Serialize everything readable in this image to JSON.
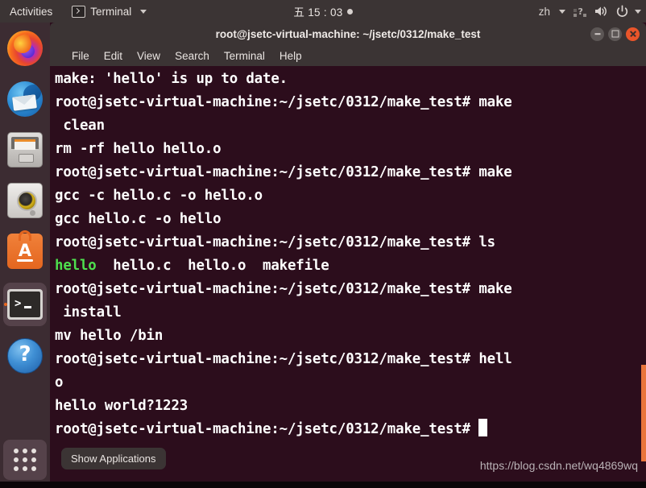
{
  "topbar": {
    "activities": "Activities",
    "app_name": "Terminal",
    "app_icon": "terminal-icon",
    "clock": "五 15 : 03",
    "language": "zh",
    "network_icon": "network-icon",
    "volume_icon": "volume-icon",
    "power_icon": "power-icon",
    "caret_icon": "chevron-down-icon"
  },
  "dock": {
    "items": [
      {
        "name": "firefox",
        "label": "Firefox Web Browser",
        "active": false
      },
      {
        "name": "thunderbird",
        "label": "Thunderbird Mail",
        "active": false
      },
      {
        "name": "files",
        "label": "Files",
        "active": false
      },
      {
        "name": "rhythmbox",
        "label": "Rhythmbox",
        "active": false
      },
      {
        "name": "ubuntu-software",
        "label": "Ubuntu Software",
        "active": false
      },
      {
        "name": "terminal",
        "label": "Terminal",
        "active": true
      },
      {
        "name": "help",
        "label": "Help",
        "active": false
      }
    ],
    "show_applications": "Show Applications",
    "show_applications_icon": "grid-icon"
  },
  "window": {
    "title": "root@jsetc-virtual-machine: ~/jsetc/0312/make_test",
    "controls": {
      "minimize": "minimize-button",
      "maximize": "maximize-button",
      "close": "close-button"
    },
    "menu": [
      "File",
      "Edit",
      "View",
      "Search",
      "Terminal",
      "Help"
    ]
  },
  "terminal": {
    "prompt": "root@jsetc-virtual-machine:~/jsetc/0312/make_test#",
    "colors": {
      "background": "#2c0d1c",
      "foreground": "#ffffff",
      "green": "#4ee04e",
      "scrollbar": "#e8753b"
    },
    "lines": [
      {
        "segments": [
          {
            "text": "make: 'hello' is up to date."
          }
        ]
      },
      {
        "segments": [
          {
            "text": "root@jsetc-virtual-machine:~/jsetc/0312/make_test# make"
          }
        ]
      },
      {
        "segments": [
          {
            "text": " clean"
          }
        ]
      },
      {
        "segments": [
          {
            "text": "rm -rf hello hello.o"
          }
        ]
      },
      {
        "segments": [
          {
            "text": "root@jsetc-virtual-machine:~/jsetc/0312/make_test# make"
          }
        ]
      },
      {
        "segments": [
          {
            "text": "gcc -c hello.c -o hello.o"
          }
        ]
      },
      {
        "segments": [
          {
            "text": "gcc hello.c -o hello"
          }
        ]
      },
      {
        "segments": [
          {
            "text": "root@jsetc-virtual-machine:~/jsetc/0312/make_test# ls"
          }
        ]
      },
      {
        "segments": [
          {
            "text": "hello",
            "color": "green"
          },
          {
            "text": "  hello.c  hello.o  makefile"
          }
        ]
      },
      {
        "segments": [
          {
            "text": "root@jsetc-virtual-machine:~/jsetc/0312/make_test# make"
          }
        ]
      },
      {
        "segments": [
          {
            "text": " install"
          }
        ]
      },
      {
        "segments": [
          {
            "text": "mv hello /bin"
          }
        ]
      },
      {
        "segments": [
          {
            "text": "root@jsetc-virtual-machine:~/jsetc/0312/make_test# hell"
          }
        ]
      },
      {
        "segments": [
          {
            "text": "o"
          }
        ]
      },
      {
        "segments": [
          {
            "text": "hello world?1223"
          }
        ]
      },
      {
        "segments": [
          {
            "text": "root@jsetc-virtual-machine:~/jsetc/0312/make_test# "
          },
          {
            "cursor": true
          }
        ]
      }
    ]
  },
  "desktop": {
    "watermark": "https://blog.csdn.net/wq4869wq"
  }
}
